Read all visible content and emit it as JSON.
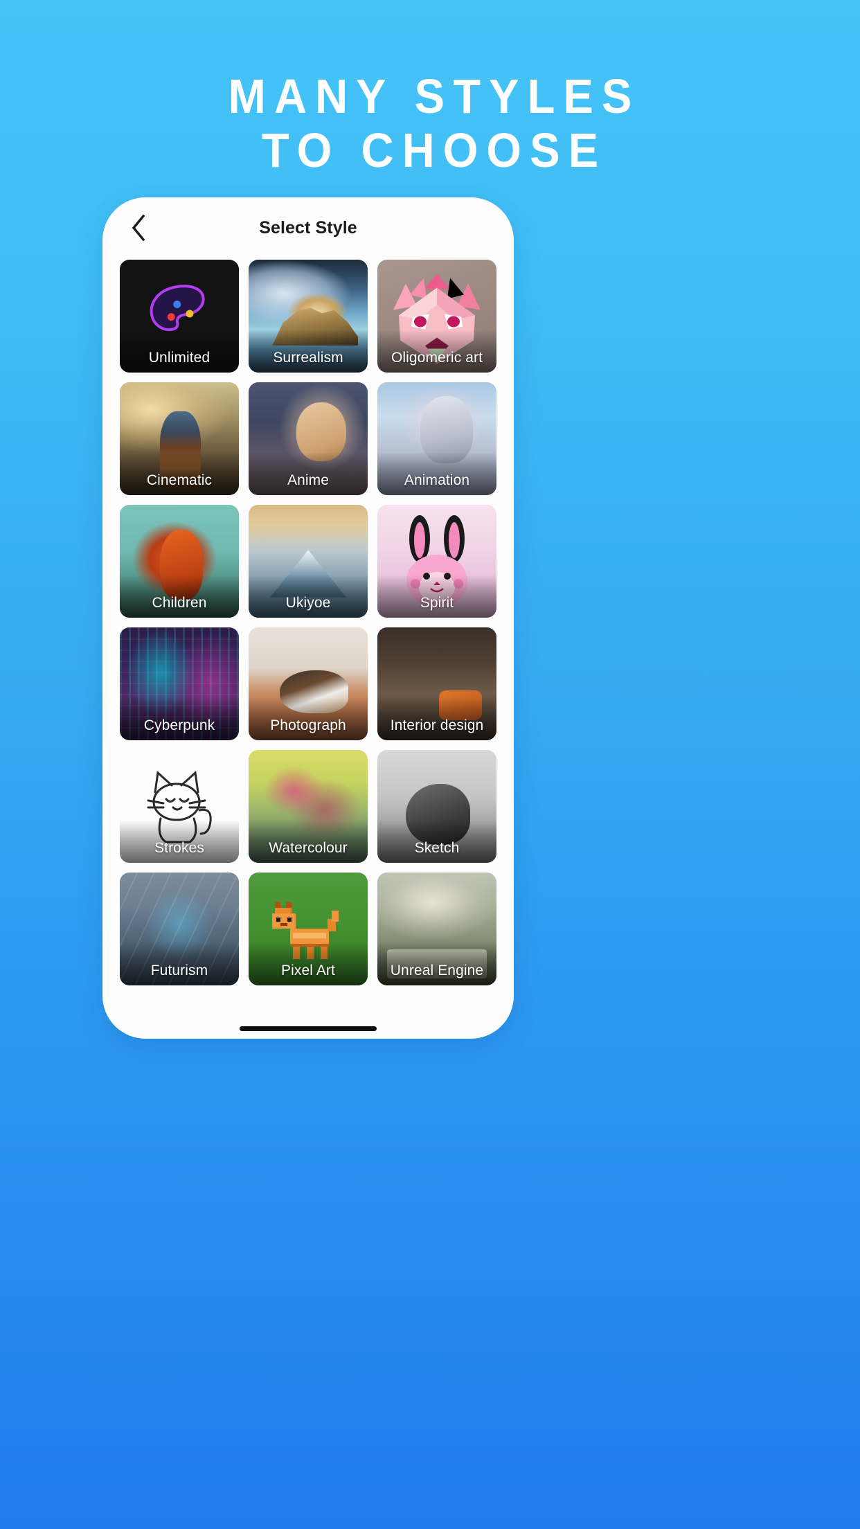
{
  "headline": {
    "line1": "MANY STYLES",
    "line2": "TO CHOOSE"
  },
  "colors": {
    "background_top": "#46c3f7",
    "background_bottom": "#1f7ced",
    "card_background": "#fdfdfd",
    "title_text": "#1b1b1b",
    "tile_label": "#ffffff"
  },
  "phone": {
    "nav": {
      "back_icon": "chevron-left-icon",
      "title": "Select Style"
    },
    "styles": [
      {
        "label": "Unlimited",
        "art": "art-unlimited",
        "selected": true,
        "icon": "palette-icon"
      },
      {
        "label": "Surrealism",
        "art": "art-surrealism",
        "selected": false,
        "icon": ""
      },
      {
        "label": "Oligomeric art",
        "art": "art-oligo",
        "selected": false,
        "icon": "low-poly-wolf-icon"
      },
      {
        "label": "Cinematic",
        "art": "art-cinematic",
        "selected": false,
        "icon": ""
      },
      {
        "label": "Anime",
        "art": "art-anime",
        "selected": false,
        "icon": ""
      },
      {
        "label": "Animation",
        "art": "art-animation",
        "selected": false,
        "icon": ""
      },
      {
        "label": "Children",
        "art": "art-children",
        "selected": false,
        "icon": ""
      },
      {
        "label": "Ukiyoe",
        "art": "art-ukiyoe",
        "selected": false,
        "icon": ""
      },
      {
        "label": "Spirit",
        "art": "art-spirit",
        "selected": false,
        "icon": "bunny-icon"
      },
      {
        "label": "Cyberpunk",
        "art": "art-cyberpunk",
        "selected": false,
        "icon": ""
      },
      {
        "label": "Photograph",
        "art": "art-photograph",
        "selected": false,
        "icon": ""
      },
      {
        "label": "Interior design",
        "art": "art-interior",
        "selected": false,
        "icon": ""
      },
      {
        "label": "Strokes",
        "art": "art-strokes",
        "selected": false,
        "icon": "line-cat-icon"
      },
      {
        "label": "Watercolour",
        "art": "art-watercolour",
        "selected": false,
        "icon": ""
      },
      {
        "label": "Sketch",
        "art": "art-sketch",
        "selected": false,
        "icon": ""
      },
      {
        "label": "Futurism",
        "art": "art-futurism",
        "selected": false,
        "icon": ""
      },
      {
        "label": "Pixel Art",
        "art": "art-pixel",
        "selected": false,
        "icon": "pixel-cat-icon"
      },
      {
        "label": "Unreal Engine",
        "art": "art-unreal",
        "selected": false,
        "icon": ""
      }
    ],
    "home_indicator": "home-indicator"
  }
}
